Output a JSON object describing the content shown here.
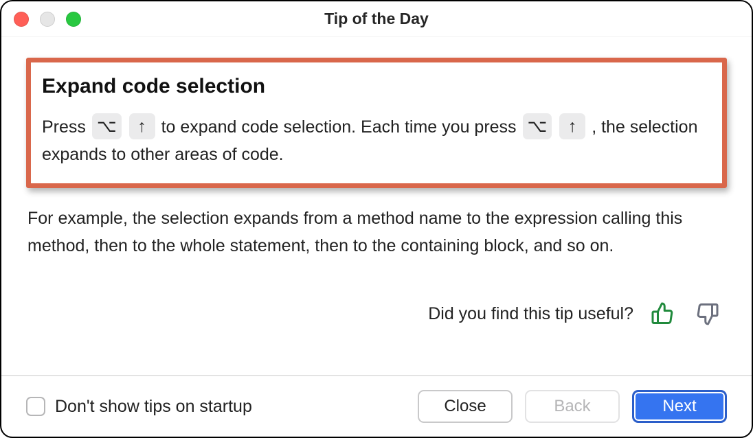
{
  "window": {
    "title": "Tip of the Day"
  },
  "tip": {
    "heading": "Expand code selection",
    "para1_a": "Press ",
    "para1_b": " to expand code selection. Each time you press ",
    "para1_c": " , the selection expands to other areas of code.",
    "key_option": "⌥",
    "key_up": "↑",
    "para2": "For example, the selection expands from a method name to the expression calling this method, then to the whole statement, then to the containing block, and so on."
  },
  "feedback": {
    "prompt": "Did you find this tip useful?"
  },
  "footer": {
    "checkbox_label": "Don't show tips on startup",
    "close": "Close",
    "back": "Back",
    "next": "Next"
  }
}
